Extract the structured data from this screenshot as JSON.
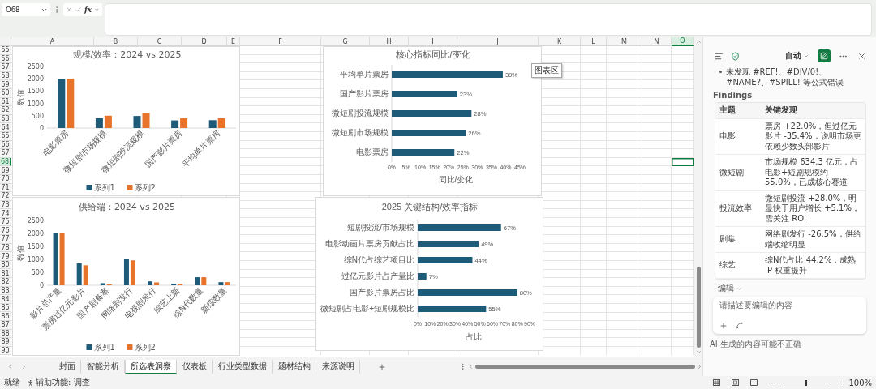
{
  "formula_bar": {
    "name_box": "O68",
    "function_label": "fx"
  },
  "sheet": {
    "columns": [
      {
        "label": "A",
        "selected": false
      },
      {
        "label": "B",
        "selected": false
      },
      {
        "label": "C",
        "selected": false
      },
      {
        "label": "D",
        "selected": false
      },
      {
        "label": "E",
        "selected": false
      },
      {
        "label": "F",
        "selected": false
      },
      {
        "label": "G",
        "selected": false
      },
      {
        "label": "H",
        "selected": false
      },
      {
        "label": "I",
        "selected": false
      },
      {
        "label": "J",
        "selected": false
      },
      {
        "label": "K",
        "selected": false
      },
      {
        "label": "L",
        "selected": false
      },
      {
        "label": "M",
        "selected": false
      },
      {
        "label": "N",
        "selected": false
      },
      {
        "label": "O",
        "selected": true
      }
    ],
    "rows": [
      {
        "label": "55",
        "selected": false
      },
      {
        "label": "56",
        "selected": false
      },
      {
        "label": "57",
        "selected": false
      },
      {
        "label": "58",
        "selected": false
      },
      {
        "label": "59",
        "selected": false
      },
      {
        "label": "60",
        "selected": false
      },
      {
        "label": "61",
        "selected": false
      },
      {
        "label": "62",
        "selected": false
      },
      {
        "label": "63",
        "selected": false
      },
      {
        "label": "64",
        "selected": false
      },
      {
        "label": "65",
        "selected": false
      },
      {
        "label": "66",
        "selected": false
      },
      {
        "label": "67",
        "selected": false
      },
      {
        "label": "68",
        "selected": true
      },
      {
        "label": "69",
        "selected": false
      },
      {
        "label": "70",
        "selected": false
      },
      {
        "label": "71",
        "selected": false
      },
      {
        "label": "72",
        "selected": false
      },
      {
        "label": "73",
        "selected": false
      },
      {
        "label": "74",
        "selected": false
      },
      {
        "label": "75",
        "selected": false
      },
      {
        "label": "76",
        "selected": false
      },
      {
        "label": "77",
        "selected": false
      },
      {
        "label": "78",
        "selected": false
      },
      {
        "label": "79",
        "selected": false
      },
      {
        "label": "80",
        "selected": false
      },
      {
        "label": "81",
        "selected": false
      },
      {
        "label": "82",
        "selected": false
      },
      {
        "label": "83",
        "selected": false
      },
      {
        "label": "84",
        "selected": false
      },
      {
        "label": "85",
        "selected": false
      },
      {
        "label": "86",
        "selected": false
      },
      {
        "label": "87",
        "selected": false
      },
      {
        "label": "88",
        "selected": false
      },
      {
        "label": "89",
        "selected": false
      },
      {
        "label": "90",
        "selected": false
      }
    ],
    "charts": [
      {
        "chart_data": {
          "type": "bar",
          "orientation": "vertical",
          "title": "规模/效率：2024 vs 2025",
          "ylabel": "数值",
          "categories": [
            "电影票房",
            "微短剧市场规模",
            "微短剧投流规模",
            "国产影片票房",
            "平均单片票房"
          ],
          "ylim": [
            0,
            2500
          ],
          "yticks": [
            0,
            500,
            1000,
            1500,
            2000,
            2500
          ],
          "legend": "bottom",
          "series": [
            {
              "name": "系列1",
              "color": "#1d5b79",
              "values": [
                2000,
                400,
                490,
                310,
                320
              ]
            },
            {
              "name": "系列2",
              "color": "#e8742c",
              "values": [
                2000,
                500,
                620,
                400,
                400
              ]
            }
          ]
        }
      },
      {
        "chart_data": {
          "type": "bar",
          "orientation": "horizontal",
          "title": "核心指标同比/变化",
          "xlabel": "同比/变化",
          "categories": [
            "平均单片票房",
            "国产影片票房",
            "微短剧投流规模",
            "微短剧市场规模",
            "电影票房"
          ],
          "xlim": [
            0,
            0.45
          ],
          "xticks": [
            {
              "value": 0,
              "label": "0%"
            },
            {
              "value": 0.05,
              "label": "5%"
            },
            {
              "value": 0.1,
              "label": "10%"
            },
            {
              "value": 0.15,
              "label": "15%"
            },
            {
              "value": 0.2,
              "label": "20%"
            },
            {
              "value": 0.25,
              "label": "25%"
            },
            {
              "value": 0.3,
              "label": "30%"
            },
            {
              "value": 0.35,
              "label": "35%"
            },
            {
              "value": 0.4,
              "label": "40%"
            },
            {
              "value": 0.45,
              "label": "45%"
            }
          ],
          "series": [
            {
              "color": "#1d5b79",
              "values": [
                0.39,
                0.23,
                0.28,
                0.26,
                0.22
              ]
            }
          ],
          "value_labels": [
            "39%",
            "23%",
            "28%",
            "26%",
            "22%"
          ]
        },
        "tooltip": "图表区"
      },
      {
        "chart_data": {
          "type": "bar",
          "orientation": "vertical",
          "title": "供给端：2024 vs 2025",
          "ylabel": "数值",
          "categories": [
            "影片总产量",
            "票房过亿元影片",
            "国产剧备案",
            "网络剧发行",
            "电视剧发行",
            "综艺上新",
            "综N代数量",
            "新综数量"
          ],
          "ylim": [
            0,
            2500
          ],
          "yticks": [
            0,
            500,
            1000,
            1500,
            2000,
            2500
          ],
          "legend": "bottom",
          "series": [
            {
              "name": "系列1",
              "color": "#1d5b79",
              "values": [
                2000,
                850,
                80,
                1000,
                150,
                60,
                310,
                120
              ]
            },
            {
              "name": "系列2",
              "color": "#e8742c",
              "values": [
                2000,
                770,
                40,
                960,
                110,
                50,
                310,
                120
              ]
            }
          ]
        }
      },
      {
        "chart_data": {
          "type": "bar",
          "orientation": "horizontal",
          "title": "2025 关键结构/效率指标",
          "xlabel": "占比",
          "categories": [
            "短剧投流/市场规模",
            "电影动画片票房贡献占比",
            "综N代占综艺项目比",
            "过亿元影片占产量比",
            "国产影片票房占比",
            "微短剧占电影+短剧规模比"
          ],
          "xlim": [
            0,
            0.9
          ],
          "xticks": [
            {
              "value": 0,
              "label": "0%"
            },
            {
              "value": 0.1,
              "label": "10%"
            },
            {
              "value": 0.2,
              "label": "20%"
            },
            {
              "value": 0.3,
              "label": "30%"
            },
            {
              "value": 0.4,
              "label": "40%"
            },
            {
              "value": 0.5,
              "label": "50%"
            },
            {
              "value": 0.6,
              "label": "60%"
            },
            {
              "value": 0.7,
              "label": "70%"
            },
            {
              "value": 0.8,
              "label": "80%"
            },
            {
              "value": 0.9,
              "label": "90%"
            }
          ],
          "series": [
            {
              "color": "#1d5b79",
              "values": [
                0.67,
                0.49,
                0.44,
                0.07,
                0.8,
                0.55
              ]
            }
          ],
          "value_labels": [
            "67%",
            "49%",
            "44%",
            "7%",
            "80%",
            "55%"
          ]
        }
      }
    ]
  },
  "sheet_tabs": [
    {
      "label": "封面",
      "selected": false
    },
    {
      "label": "智能分析",
      "selected": false
    },
    {
      "label": "所选表洞察",
      "selected": true
    },
    {
      "label": "仪表板",
      "selected": false
    },
    {
      "label": "行业类型数据",
      "selected": false
    },
    {
      "label": "题材结构",
      "selected": false
    },
    {
      "label": "来源说明",
      "selected": false
    }
  ],
  "pane": {
    "mode": "自动",
    "bullets": [
      "未发现 #REF!、#DIV/0!、#NAME?、#SPILL! 等公式错误"
    ],
    "findings_title": "Findings",
    "table": {
      "columns": [
        "主题",
        "关键发现"
      ],
      "rows": [
        {
          "topic": "电影",
          "finding": "票房 +22.0%，但过亿元影片 -35.4%，说明市场更依赖少数头部影片"
        },
        {
          "topic": "微短剧",
          "finding": "市场规模 634.3 亿元，占电影+短剧规模约 55.0%，已成核心赛道"
        },
        {
          "topic": "投流效率",
          "finding": "微短剧投流 +28.0%，明显快于用户增长 +5.1%，需关注 ROI"
        },
        {
          "topic": "剧集",
          "finding": "网络剧发行 -26.5%，供给端收缩明显"
        },
        {
          "topic": "综艺",
          "finding": "综N代占比 44.2%，成熟 IP 权重提升"
        }
      ]
    },
    "edit_label": "编辑",
    "input": {
      "placeholder": "请描述要编辑的内容"
    },
    "disclaimer": "AI 生成的内容可能不正确"
  },
  "status_bar": {
    "ready": "就绪",
    "accessibility": "辅助功能: 调查",
    "zoom_slider": {
      "level": 0.5
    },
    "zoom": "100%"
  }
}
